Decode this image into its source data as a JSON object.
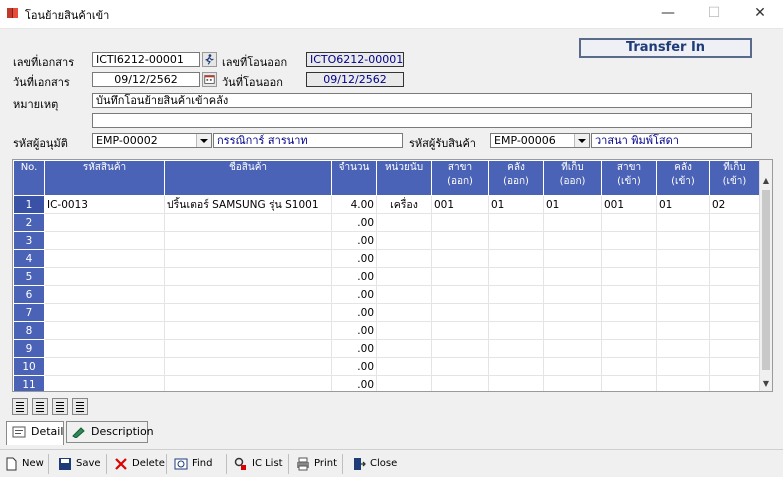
{
  "window": {
    "title": "โอนย้ายสินค้าเข้า"
  },
  "header": {
    "badge": "Transfer In",
    "doc_no_label": "เลขที่เอกสาร",
    "doc_no": "ICTI6212-00001",
    "transfer_out_label": "เลขที่โอนออก",
    "transfer_out_no": "ICTO6212-00001",
    "doc_date_label": "วันที่เอกสาร",
    "doc_date": "09/12/2562",
    "transfer_out_date_label": "วันที่โอนออก",
    "transfer_out_date": "09/12/2562",
    "remark_label": "หมายเหตุ",
    "remark1": "บันทึกโอนย้ายสินค้าเข้าคลัง",
    "remark2": "",
    "approver_label": "รหัสผู้อนุมัติ",
    "approver_code": "EMP-00002",
    "approver_name": "กรรณิการ์ สารนาท",
    "receiver_label": "รหัสผู้รับสินค้า",
    "receiver_code": "EMP-00006",
    "receiver_name": "วาสนา  พิมพ์โสดา"
  },
  "grid": {
    "columns": [
      {
        "line1": "No.",
        "line2": ""
      },
      {
        "line1": "รหัสสินค้า",
        "line2": ""
      },
      {
        "line1": "ชื่อสินค้า",
        "line2": ""
      },
      {
        "line1": "จำนวน",
        "line2": ""
      },
      {
        "line1": "หน่วยนับ",
        "line2": ""
      },
      {
        "line1": "สาขา",
        "line2": "(ออก)"
      },
      {
        "line1": "คลัง",
        "line2": "(ออก)"
      },
      {
        "line1": "ที่เก็บ",
        "line2": "(ออก)"
      },
      {
        "line1": "สาขา",
        "line2": "(เข้า)"
      },
      {
        "line1": "คลัง",
        "line2": "(เข้า)"
      },
      {
        "line1": "ที่เก็บ",
        "line2": "(เข้า)"
      }
    ],
    "rows": [
      {
        "no": "1",
        "code": "IC-0013",
        "name": "ปริ้นเตอร์ SAMSUNG รุ่น S1001",
        "qty": "4.00",
        "unit": "เครื่อง",
        "br_out": "001",
        "wh_out": "01",
        "loc_out": "01",
        "br_in": "001",
        "wh_in": "01",
        "loc_in": "02"
      },
      {
        "no": "2",
        "code": "",
        "name": "",
        "qty": ".00",
        "unit": "",
        "br_out": "",
        "wh_out": "",
        "loc_out": "",
        "br_in": "",
        "wh_in": "",
        "loc_in": ""
      },
      {
        "no": "3",
        "code": "",
        "name": "",
        "qty": ".00",
        "unit": "",
        "br_out": "",
        "wh_out": "",
        "loc_out": "",
        "br_in": "",
        "wh_in": "",
        "loc_in": ""
      },
      {
        "no": "4",
        "code": "",
        "name": "",
        "qty": ".00",
        "unit": "",
        "br_out": "",
        "wh_out": "",
        "loc_out": "",
        "br_in": "",
        "wh_in": "",
        "loc_in": ""
      },
      {
        "no": "5",
        "code": "",
        "name": "",
        "qty": ".00",
        "unit": "",
        "br_out": "",
        "wh_out": "",
        "loc_out": "",
        "br_in": "",
        "wh_in": "",
        "loc_in": ""
      },
      {
        "no": "6",
        "code": "",
        "name": "",
        "qty": ".00",
        "unit": "",
        "br_out": "",
        "wh_out": "",
        "loc_out": "",
        "br_in": "",
        "wh_in": "",
        "loc_in": ""
      },
      {
        "no": "7",
        "code": "",
        "name": "",
        "qty": ".00",
        "unit": "",
        "br_out": "",
        "wh_out": "",
        "loc_out": "",
        "br_in": "",
        "wh_in": "",
        "loc_in": ""
      },
      {
        "no": "8",
        "code": "",
        "name": "",
        "qty": ".00",
        "unit": "",
        "br_out": "",
        "wh_out": "",
        "loc_out": "",
        "br_in": "",
        "wh_in": "",
        "loc_in": ""
      },
      {
        "no": "9",
        "code": "",
        "name": "",
        "qty": ".00",
        "unit": "",
        "br_out": "",
        "wh_out": "",
        "loc_out": "",
        "br_in": "",
        "wh_in": "",
        "loc_in": ""
      },
      {
        "no": "10",
        "code": "",
        "name": "",
        "qty": ".00",
        "unit": "",
        "br_out": "",
        "wh_out": "",
        "loc_out": "",
        "br_in": "",
        "wh_in": "",
        "loc_in": ""
      },
      {
        "no": "11",
        "code": "",
        "name": "",
        "qty": ".00",
        "unit": "",
        "br_out": "",
        "wh_out": "",
        "loc_out": "",
        "br_in": "",
        "wh_in": "",
        "loc_in": ""
      }
    ]
  },
  "tabs": [
    {
      "label": "Detail"
    },
    {
      "label": "Description"
    }
  ],
  "toolbar": {
    "new": "New",
    "save": "Save",
    "delete": "Delete",
    "find": "Find",
    "ic_list": "IC List",
    "print": "Print",
    "close": "Close"
  },
  "colors": {
    "grid_header": "#4b63b6",
    "badge_text": "#1e3c78",
    "readonly_text": "#00008b"
  }
}
